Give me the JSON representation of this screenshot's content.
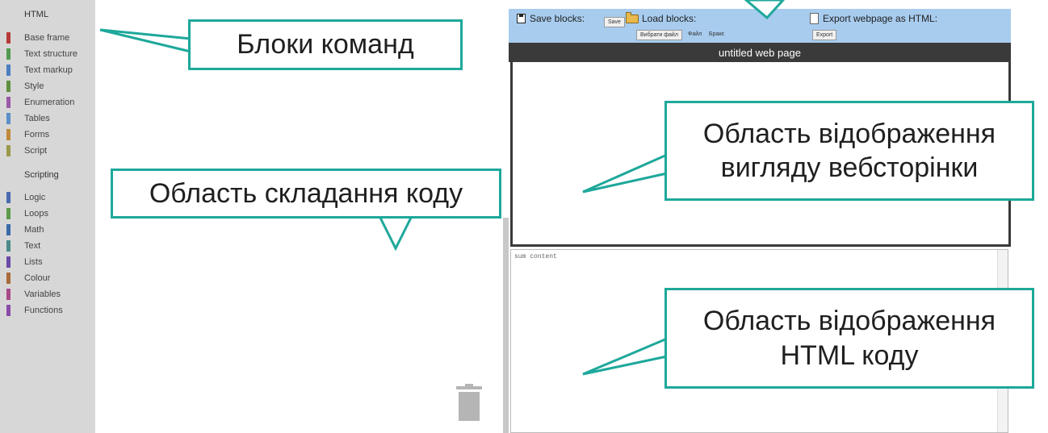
{
  "toolbox": {
    "html_header": "HTML",
    "scripting_header": "Scripting",
    "html_categories": [
      {
        "label": "Base frame",
        "color": "#b63a3a"
      },
      {
        "label": "Text structure",
        "color": "#4f9a4f"
      },
      {
        "label": "Text markup",
        "color": "#4a7fc0"
      },
      {
        "label": "Style",
        "color": "#5e8f3e"
      },
      {
        "label": "Enumeration",
        "color": "#9a58a8"
      },
      {
        "label": "Tables",
        "color": "#5b8fc8"
      },
      {
        "label": "Forms",
        "color": "#c08a3a"
      },
      {
        "label": "Script",
        "color": "#9a9a4a"
      }
    ],
    "scripting_categories": [
      {
        "label": "Logic",
        "color": "#4a6ab0"
      },
      {
        "label": "Loops",
        "color": "#5a9a4a"
      },
      {
        "label": "Math",
        "color": "#3a6aa8"
      },
      {
        "label": "Text",
        "color": "#4a8a8a"
      },
      {
        "label": "Lists",
        "color": "#6a4aa8"
      },
      {
        "label": "Colour",
        "color": "#a86a3a"
      },
      {
        "label": "Variables",
        "color": "#a84a8a"
      },
      {
        "label": "Functions",
        "color": "#8a4aa8"
      }
    ]
  },
  "toolbar": {
    "save_label": "Save blocks:",
    "save_button": "Save",
    "load_label": "Load blocks:",
    "choose_file_button": "Вибрати файл",
    "file_status_1": "Файл",
    "file_status_2": "Бракє",
    "export_label": "Export webpage as HTML:",
    "export_button": "Export"
  },
  "preview": {
    "title": "untitled web page"
  },
  "code": {
    "text": "sum content"
  },
  "callouts": {
    "blocks": "Блоки команд",
    "composition": "Область складання коду",
    "preview": [
      "Область відображення",
      "вигляду вебсторінки"
    ],
    "html_code": [
      "Область відображення",
      "HTML коду"
    ]
  },
  "colors": {
    "accent": "#1ea89b",
    "toolbar_bg": "#a8ccee",
    "title_bar_bg": "#3a3a3a",
    "toolbox_bg": "#d7d7d7"
  },
  "icons": [
    "save-disk-icon",
    "folder-icon",
    "document-icon",
    "trash-icon"
  ]
}
